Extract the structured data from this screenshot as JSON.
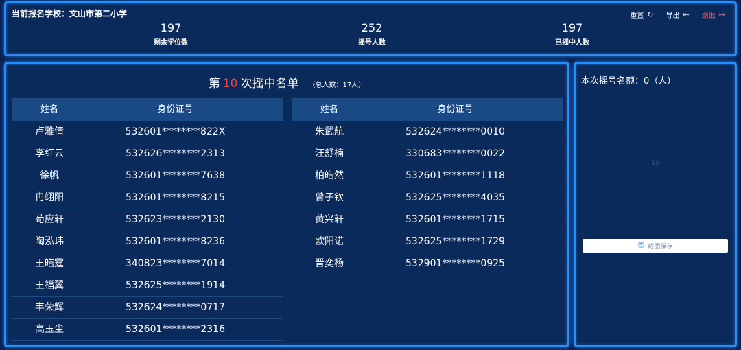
{
  "header": {
    "school_label": "当前报名学校：文山市第二小学",
    "actions": [
      {
        "label": "重置",
        "icon": "refresh-icon",
        "glyph": "↻"
      },
      {
        "label": "导出",
        "icon": "export-icon",
        "glyph": "⇤"
      },
      {
        "label": "退出",
        "icon": "logout-icon",
        "glyph": "↦"
      }
    ],
    "stats": [
      {
        "value": "197",
        "label": "剩余学位数"
      },
      {
        "value": "252",
        "label": "摇号人数"
      },
      {
        "value": "197",
        "label": "已摇中人数"
      }
    ]
  },
  "list": {
    "title_prefix": "第",
    "round": "10",
    "title_suffix": "次摇中名单",
    "total": "（总人数：17人）",
    "col_name": "姓名",
    "col_id": "身份证号",
    "left_rows": [
      {
        "name": "卢雅倩",
        "id": "532601********822X"
      },
      {
        "name": "李红云",
        "id": "532626********2313"
      },
      {
        "name": "徐帆",
        "id": "532601********7638"
      },
      {
        "name": "冉翊阳",
        "id": "532601********8215"
      },
      {
        "name": "苟应轩",
        "id": "532623********2130"
      },
      {
        "name": "陶泓玮",
        "id": "532601********8236"
      },
      {
        "name": "王皓霆",
        "id": "340823********7014"
      },
      {
        "name": "王福翼",
        "id": "532625********1914"
      },
      {
        "name": "丰荣辉",
        "id": "532624********0717"
      },
      {
        "name": "高玉尘",
        "id": "532601********2316"
      }
    ],
    "right_rows": [
      {
        "name": "朱武航",
        "id": "532624********0010"
      },
      {
        "name": "汪舒楠",
        "id": "330683********0022"
      },
      {
        "name": "柏皓然",
        "id": "532601********1118"
      },
      {
        "name": "曾子钦",
        "id": "532625********4035"
      },
      {
        "name": "黄兴轩",
        "id": "532601********1715"
      },
      {
        "name": "欧阳诺",
        "id": "532625********1729"
      },
      {
        "name": "晋奕杨",
        "id": "532901********0925"
      }
    ]
  },
  "side": {
    "quota_label": "本次摇号名额：0（人）",
    "faint_number": "10",
    "save_label": "截图保存",
    "save_icon": "save-icon"
  },
  "colors": {
    "accent_border": "#2b8cf2",
    "round_highlight": "#ff3b3b",
    "exit_red": "#ff5a5a"
  }
}
